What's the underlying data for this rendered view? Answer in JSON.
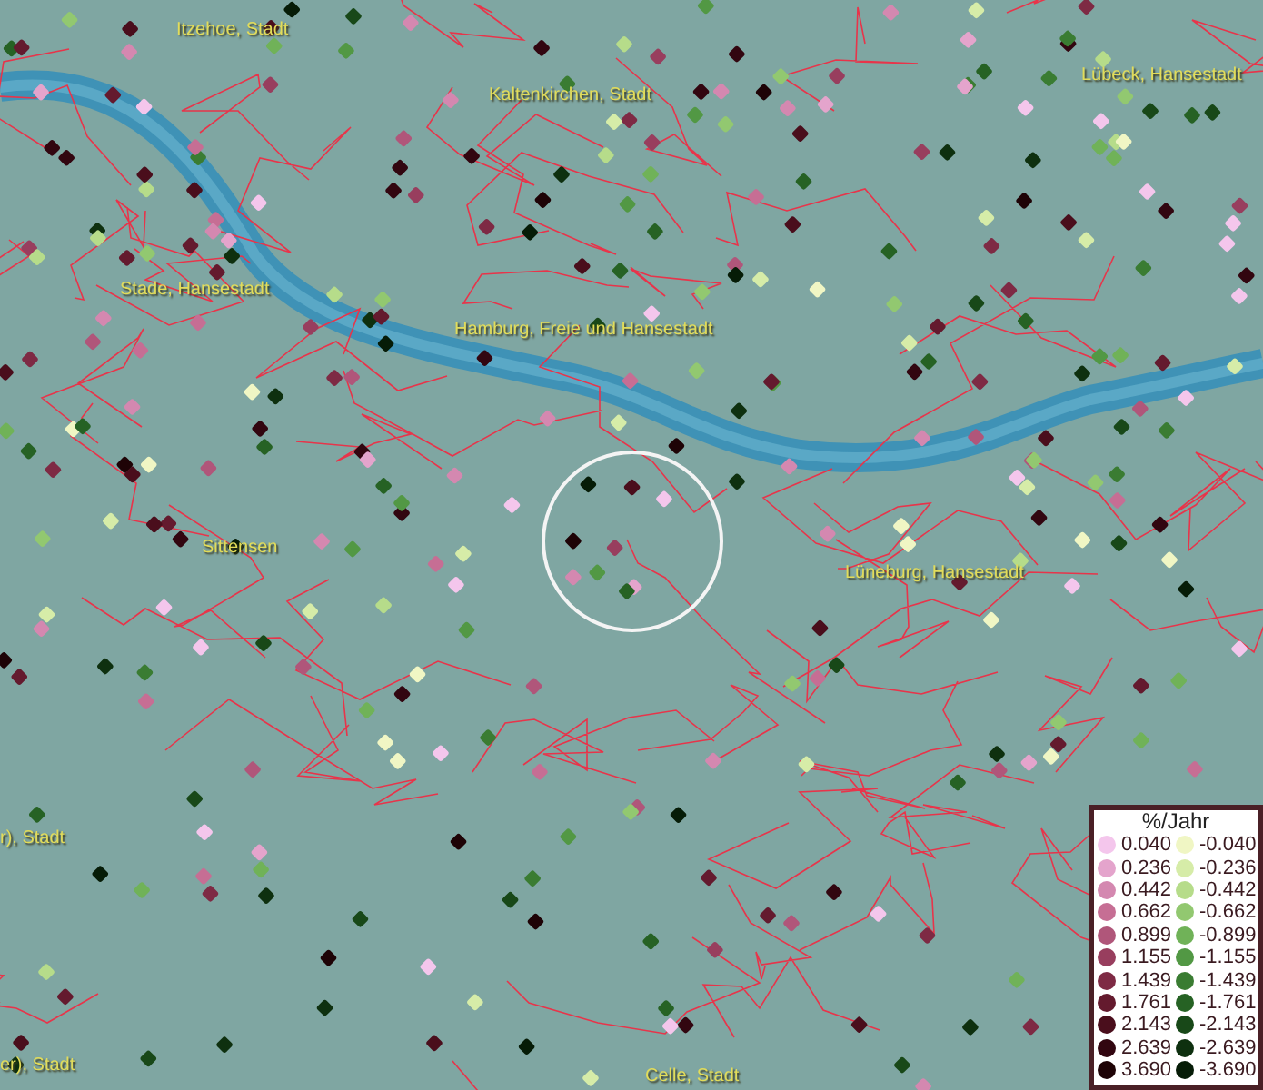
{
  "map": {
    "place_labels": [
      "Itzehoe, Stadt",
      "Kaltenkirchen, Stadt",
      "Lübeck, Hansestadt",
      "Stade, Hansestadt",
      "Hamburg, Freie und Hansestadt",
      "Sittensen",
      "Lüneburg, Hansestadt",
      "r), Stadt",
      "er), Stadt",
      "Celle, Stadt"
    ]
  },
  "legend": {
    "title": "%/Jahr",
    "items": [
      {
        "label": "0.040",
        "color": "#f4c6ec"
      },
      {
        "label": "-0.040",
        "color": "#f0f6c4"
      },
      {
        "label": "0.236",
        "color": "#e4a4cc"
      },
      {
        "label": "-0.236",
        "color": "#d6eca8"
      },
      {
        "label": "0.442",
        "color": "#d488b0"
      },
      {
        "label": "-0.442",
        "color": "#b6dc8a"
      },
      {
        "label": "0.662",
        "color": "#c66e94"
      },
      {
        "label": "-0.662",
        "color": "#92c870"
      },
      {
        "label": "0.899",
        "color": "#b0567a"
      },
      {
        "label": "-0.899",
        "color": "#70b258"
      },
      {
        "label": "1.155",
        "color": "#983e5e"
      },
      {
        "label": "-1.155",
        "color": "#529844"
      },
      {
        "label": "1.439",
        "color": "#7e2a44"
      },
      {
        "label": "-1.439",
        "color": "#3a7c32"
      },
      {
        "label": "1.761",
        "color": "#641a2e"
      },
      {
        "label": "-1.761",
        "color": "#266224"
      },
      {
        "label": "2.143",
        "color": "#4a0e1c"
      },
      {
        "label": "-2.143",
        "color": "#184818"
      },
      {
        "label": "2.639",
        "color": "#320610"
      },
      {
        "label": "-2.639",
        "color": "#0e300f"
      },
      {
        "label": "3.690",
        "color": "#1e0306"
      },
      {
        "label": "-3.690",
        "color": "#061c07"
      }
    ]
  }
}
